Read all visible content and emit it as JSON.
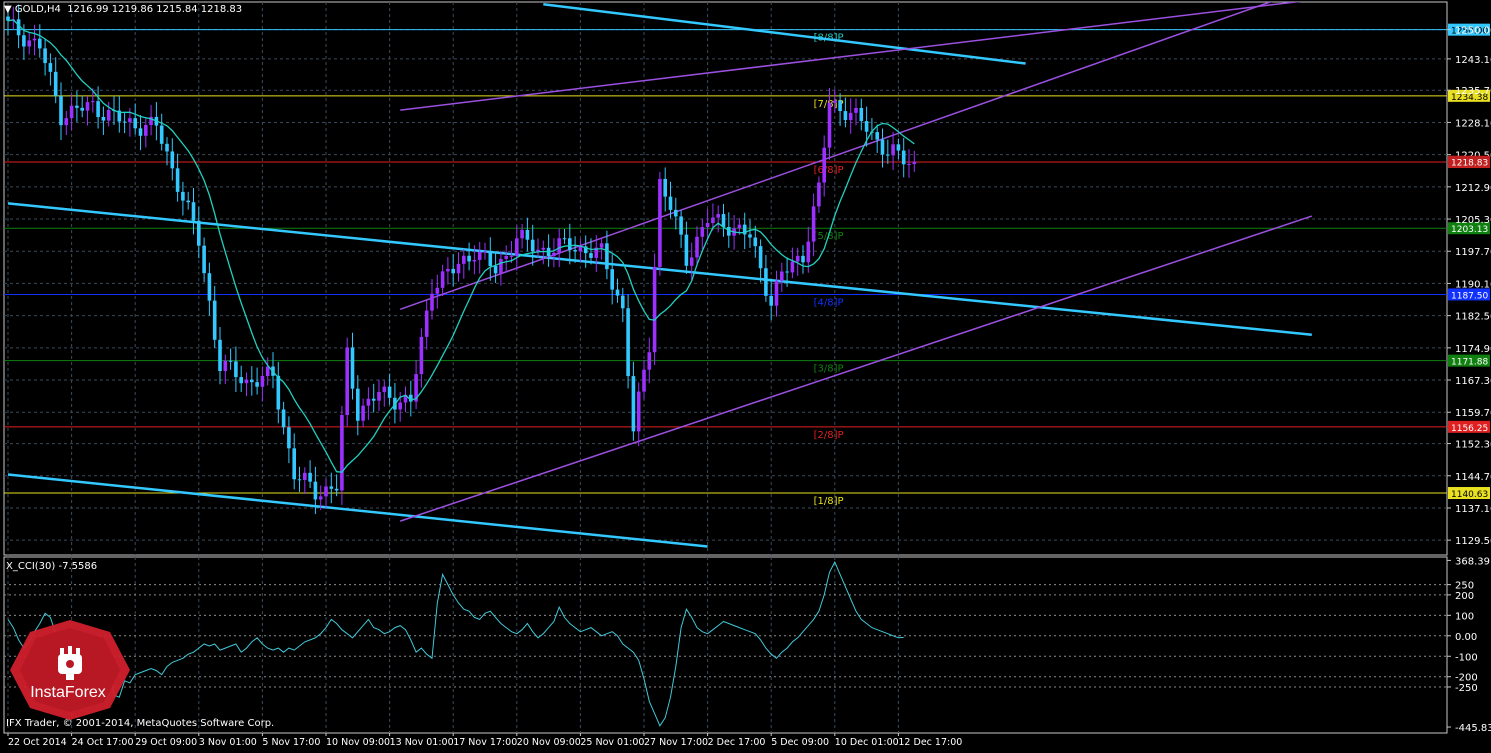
{
  "header": {
    "symbol": "GOLD,H4",
    "ohlc": "1216.99 1219.86 1215.84 1218.83",
    "indicator": "X_CCI(30) -7.5586",
    "copyright": "IFX Trader, © 2001-2014, MetaQuotes Software Corp.",
    "brand": "InstaForex"
  },
  "colors": {
    "background": "#000000",
    "grid": "#3a4a5a",
    "bull_candle": "#9b30ff",
    "bear_candle": "#33c8ff",
    "moving_average": "#20d0c0",
    "cyan_channel": "#33c8ff",
    "violet_channel": "#9b50e0",
    "cci_line": "#40c8d8",
    "logo_red": "#d0202c"
  },
  "chart_data": [
    {
      "type": "candlestick",
      "symbol": "GOLD",
      "timeframe": "H4",
      "ylim": [
        1126.0,
        1257.0
      ],
      "y_ticks": [
        "1250.00",
        "1243.10",
        "1235.70",
        "1228.10",
        "1220.50",
        "1212.90",
        "1205.30",
        "1197.70",
        "1190.10",
        "1182.50",
        "1174.90",
        "1167.30",
        "1159.70",
        "1152.30",
        "1144.70",
        "1137.10",
        "1129.50"
      ],
      "x_labels": [
        "22 Oct 2014",
        "24 Oct 17:00",
        "29 Oct 09:00",
        "3 Nov 01:00",
        "5 Nov 17:00",
        "10 Nov 09:00",
        "13 Nov 01:00",
        "17 Nov 17:00",
        "20 Nov 09:00",
        "25 Nov 01:00",
        "27 Nov 17:00",
        "2 Dec 17:00",
        "5 Dec 09:00",
        "10 Dec 01:00",
        "12 Dec 17:00"
      ],
      "x_label_index": [
        0,
        12,
        24,
        36,
        48,
        60,
        72,
        84,
        96,
        108,
        120,
        132,
        144,
        156,
        168
      ],
      "bar_count": 172,
      "close_path": [
        [
          0,
          1251
        ],
        [
          6,
          1246
        ],
        [
          10,
          1230
        ],
        [
          16,
          1232
        ],
        [
          22,
          1228
        ],
        [
          28,
          1227
        ],
        [
          32,
          1214
        ],
        [
          36,
          1200
        ],
        [
          40,
          1171
        ],
        [
          45,
          1167
        ],
        [
          50,
          1168
        ],
        [
          54,
          1145
        ],
        [
          58,
          1141
        ],
        [
          62,
          1142
        ],
        [
          64,
          1173
        ],
        [
          66,
          1160
        ],
        [
          70,
          1164
        ],
        [
          76,
          1162
        ],
        [
          80,
          1190
        ],
        [
          84,
          1193
        ],
        [
          88,
          1198
        ],
        [
          92,
          1193
        ],
        [
          96,
          1201
        ],
        [
          100,
          1198
        ],
        [
          106,
          1199
        ],
        [
          112,
          1197
        ],
        [
          116,
          1184
        ],
        [
          118,
          1155
        ],
        [
          121,
          1176
        ],
        [
          123,
          1214
        ],
        [
          125,
          1208
        ],
        [
          128,
          1196
        ],
        [
          132,
          1205
        ],
        [
          136,
          1204
        ],
        [
          140,
          1201
        ],
        [
          144,
          1186
        ],
        [
          146,
          1192
        ],
        [
          150,
          1197
        ],
        [
          153,
          1212
        ],
        [
          155,
          1233
        ],
        [
          158,
          1231
        ],
        [
          162,
          1227
        ],
        [
          166,
          1221
        ],
        [
          170,
          1219
        ],
        [
          171,
          1218.83
        ]
      ],
      "candle_range": 2.2,
      "ma_period": 12,
      "murrey_levels": [
        {
          "label": "[8/8]P",
          "price": 1250.0,
          "price_label": "1250.00",
          "color": "#33c8ff",
          "label_color": "#20d0c0"
        },
        {
          "label": "[7/8]P",
          "price": 1234.38,
          "price_label": "1234.38",
          "color": "#e8e020",
          "label_color": "#e8e020"
        },
        {
          "label": "[6/8]P",
          "price": 1218.75,
          "price_label": "1218.75",
          "color": "#e02020",
          "label_color": "#e02020"
        },
        {
          "label": "[5/8]P",
          "price": 1203.13,
          "price_label": "1203.13",
          "color": "#108010",
          "label_color": "#108010"
        },
        {
          "label": "[4/8]P",
          "price": 1187.5,
          "price_label": "1187.50",
          "color": "#1030ff",
          "label_color": "#1030ff"
        },
        {
          "label": "[3/8]P",
          "price": 1171.88,
          "price_label": "1171.88",
          "color": "#108010",
          "label_color": "#108010"
        },
        {
          "label": "[2/8]P",
          "price": 1156.25,
          "price_label": "1156.25",
          "color": "#e02020",
          "label_color": "#e02020"
        },
        {
          "label": "[1/8]P",
          "price": 1140.63,
          "price_label": "1140.63",
          "color": "#e8e020",
          "label_color": "#e8e020"
        }
      ],
      "murrey_label_index": 152,
      "channels": [
        {
          "name": "cyan-channel-upper",
          "color": "#33c8ff",
          "width": 2.5,
          "from": [
            101,
            1256
          ],
          "to": [
            192,
            1242
          ]
        },
        {
          "name": "cyan-channel-middle",
          "color": "#33c8ff",
          "width": 2.5,
          "from": [
            0,
            1209
          ],
          "to": [
            246,
            1178
          ]
        },
        {
          "name": "cyan-channel-lower",
          "color": "#33c8ff",
          "width": 2.5,
          "from": [
            0,
            1145
          ],
          "to": [
            132,
            1128
          ]
        },
        {
          "name": "violet-channel-upper",
          "color": "#9b50e0",
          "width": 1.5,
          "from": [
            74,
            1231
          ],
          "to": [
            246,
            1257
          ]
        },
        {
          "name": "violet-channel-middle",
          "color": "#9b50e0",
          "width": 1.5,
          "from": [
            74,
            1184
          ],
          "to": [
            246,
            1260
          ]
        },
        {
          "name": "violet-channel-lower",
          "color": "#9b50e0",
          "width": 1.5,
          "from": [
            74,
            1134
          ],
          "to": [
            246,
            1206
          ]
        }
      ],
      "current_price": 1218.83
    },
    {
      "type": "line",
      "name": "X_CCI(30)",
      "ylim": [
        -475,
        385
      ],
      "y_ticks": [
        368.3911,
        250,
        200,
        100,
        0.0,
        -100,
        -200,
        -250,
        -445.8391
      ],
      "y_tick_labels": [
        "368.3911",
        "250",
        "200",
        "100",
        "0.00",
        "-100",
        "-200",
        "-250",
        "-445.8391"
      ],
      "levels": [
        250,
        200,
        100,
        0,
        -100,
        -200,
        -250
      ],
      "last_value": -7.5586,
      "values": [
        80,
        40,
        -20,
        -60,
        -30,
        20,
        60,
        110,
        90,
        10,
        -70,
        -120,
        -80,
        -60,
        -100,
        -110,
        -150,
        -140,
        -170,
        -160,
        -290,
        -300,
        -220,
        -230,
        -190,
        -180,
        -170,
        -160,
        -170,
        -190,
        -150,
        -130,
        -120,
        -110,
        -90,
        -80,
        -60,
        -40,
        -50,
        -40,
        -70,
        -60,
        -50,
        -40,
        -80,
        -60,
        -30,
        -10,
        -40,
        -60,
        -70,
        -60,
        -80,
        -60,
        -70,
        -50,
        -30,
        -20,
        -10,
        10,
        40,
        80,
        60,
        30,
        10,
        -10,
        20,
        50,
        80,
        40,
        30,
        10,
        20,
        40,
        50,
        30,
        -20,
        -80,
        -60,
        -90,
        -110,
        160,
        300,
        250,
        200,
        160,
        130,
        120,
        90,
        80,
        110,
        120,
        90,
        60,
        40,
        20,
        10,
        30,
        60,
        20,
        -10,
        10,
        40,
        70,
        140,
        90,
        60,
        40,
        20,
        30,
        40,
        20,
        0,
        10,
        20,
        0,
        -40,
        -60,
        -80,
        -120,
        -210,
        -320,
        -380,
        -440,
        -400,
        -300,
        -150,
        40,
        130,
        90,
        40,
        20,
        10,
        30,
        50,
        70,
        60,
        50,
        40,
        30,
        20,
        10,
        -20,
        -60,
        -90,
        -110,
        -80,
        -60,
        -30,
        -10,
        20,
        50,
        80,
        120,
        200,
        310,
        360,
        300,
        240,
        180,
        120,
        80,
        60,
        40,
        30,
        20,
        10,
        0,
        -10,
        -8
      ]
    }
  ]
}
